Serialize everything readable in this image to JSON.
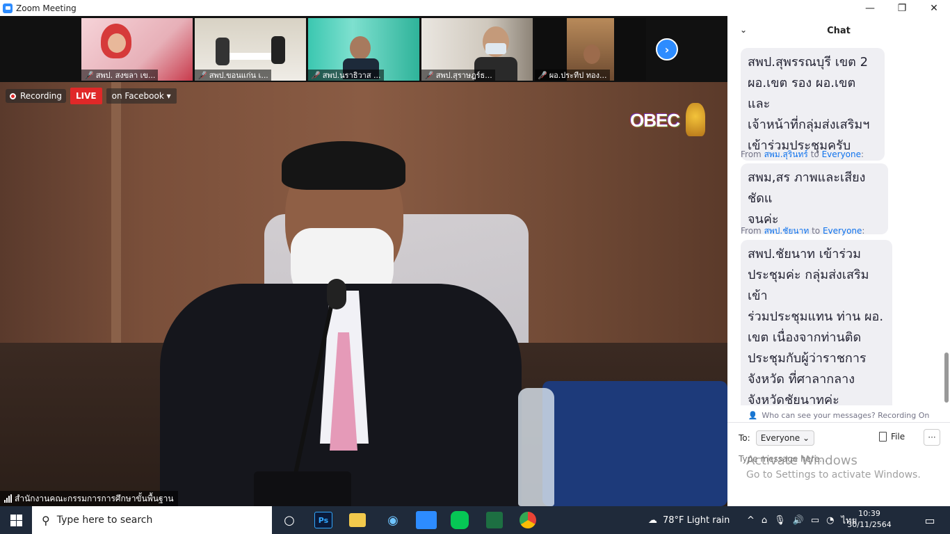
{
  "window": {
    "title": "Zoom Meeting",
    "min": "—",
    "restore": "❐",
    "close": "✕"
  },
  "thumbnails": [
    {
      "name": "สพป. สงขลา เข..."
    },
    {
      "name": "สพป.ขอนแก่น เ..."
    },
    {
      "name": "สพป.นราธิวาส ..."
    },
    {
      "name": "สพป.สุราษฎร์ธ..."
    },
    {
      "name": "ผอ.ประทีป ทอง..."
    }
  ],
  "recording": {
    "label": "Recording",
    "live": "LIVE",
    "platform": "on Facebook"
  },
  "speaker": {
    "name": "สำนักงานคณะกรรมการการศึกษาขั้นพื้นฐาน"
  },
  "logo_text": "OBEC",
  "chat": {
    "title": "Chat",
    "messages": [
      {
        "from": "",
        "to": "",
        "lines": [
          "สพป.สุพรรณบุรี เขต 2",
          "ผอ.เขต รอง ผอ.เขต และ",
          "เจ้าหน้าที่กลุ่มส่งเสริมฯ",
          "เข้าร่วมประชุมครับ"
        ]
      },
      {
        "from": "สพม.สุรินทร์",
        "to": "Everyone",
        "lines": [
          "สพม,สร ภาพและเสียงชัดแ",
          "จนค่ะ"
        ]
      },
      {
        "from": "สพป.ชัยนาท",
        "to": "Everyone",
        "lines": [
          "สพป.ชัยนาท เข้าร่วม",
          "ประชุมค่ะ กลุ่มส่งเสริมเข้า",
          "ร่วมประชุมแทน ท่าน ผอ.",
          "เขต เนื่องจากท่านติด",
          "ประชุมกับผู้ว่าราชการ",
          "จังหวัด ที่ศาลากลาง",
          "จังหวัดชัยนาทค่ะ"
        ]
      }
    ],
    "from_label": "From",
    "to_label": "to",
    "privacy": "Who can see your messages? Recording On",
    "to_prefix": "To:",
    "recipient": "Everyone",
    "file_label": "File",
    "more_label": "···",
    "input_placeholder": "Type message here..."
  },
  "watermark": {
    "line1": "Activate Windows",
    "line2": "Go to Settings to activate Windows."
  },
  "taskbar": {
    "search_placeholder": "Type here to search",
    "weather": "78°F  Light rain",
    "lang": "ไทย",
    "time": "10:39",
    "date": "30/11/2564",
    "apps": [
      "Ps"
    ]
  }
}
